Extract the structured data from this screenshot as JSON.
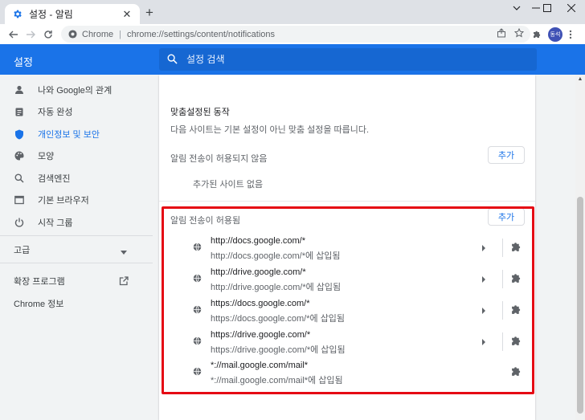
{
  "browser": {
    "tab_title": "설정 - 알림",
    "tab_close": "✕",
    "new_tab": "+",
    "omnibox_origin": "Chrome",
    "omnibox_path": "chrome://settings/content/notifications",
    "profile_initials": "동석"
  },
  "header": {
    "title": "설정",
    "search_placeholder": "설정 검색"
  },
  "sidebar": {
    "items": [
      {
        "label": "나와 Google의 관계",
        "icon": "person-icon"
      },
      {
        "label": "자동 완성",
        "icon": "clipboard-icon"
      },
      {
        "label": "개인정보 및 보안",
        "icon": "shield-icon",
        "active": true
      },
      {
        "label": "모양",
        "icon": "palette-icon"
      },
      {
        "label": "검색엔진",
        "icon": "search-icon"
      },
      {
        "label": "기본 브라우저",
        "icon": "browser-window-icon"
      },
      {
        "label": "시작 그룹",
        "icon": "power-icon"
      }
    ],
    "advanced_label": "고급",
    "extensions_label": "확장 프로그램",
    "about_label": "Chrome 정보"
  },
  "main": {
    "custom_section_title": "맞춤설정된 동작",
    "custom_section_desc": "다음 사이트는 기본 설정이 아닌 맞춤 설정을 따릅니다.",
    "blocked_title": "알림 전송이 허용되지 않음",
    "blocked_add_label": "추가",
    "blocked_empty": "추가된 사이트 없음",
    "allowed_title": "알림 전송이 허용됨",
    "allowed_add_label": "추가",
    "allowed_sites": [
      {
        "host": "http://docs.google.com/*",
        "sub": "http://docs.google.com/*에 삽입됨",
        "arrow": true
      },
      {
        "host": "http://drive.google.com/*",
        "sub": "http://drive.google.com/*에 삽입됨",
        "arrow": true
      },
      {
        "host": "https://docs.google.com/*",
        "sub": "https://docs.google.com/*에 삽입됨",
        "arrow": true
      },
      {
        "host": "https://drive.google.com/*",
        "sub": "https://drive.google.com/*에 삽입됨",
        "arrow": true
      },
      {
        "host": "*://mail.google.com/mail*",
        "sub": "*://mail.google.com/mail*에 삽입됨",
        "arrow": false
      }
    ]
  },
  "colors": {
    "accent": "#1a73e8",
    "highlight": "#e50914"
  }
}
